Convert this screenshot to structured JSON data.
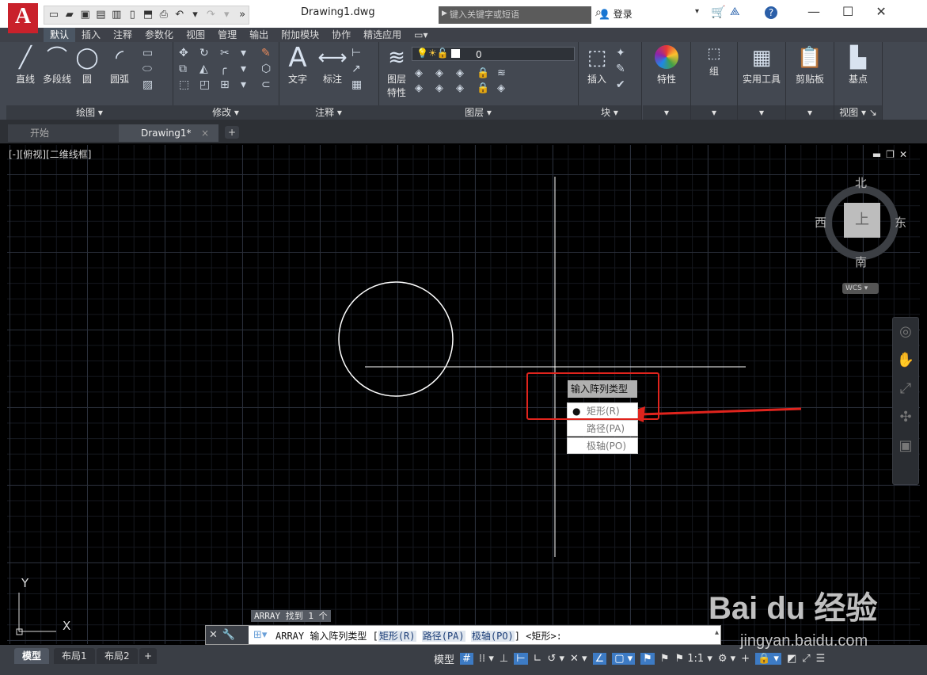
{
  "app": {
    "logo_letter": "A",
    "document_title": "Drawing1.dwg"
  },
  "search": {
    "placeholder": "键入关键字或短语"
  },
  "account": {
    "signin_label": "登录"
  },
  "ribbon_tabs": [
    "默认",
    "插入",
    "注释",
    "参数化",
    "视图",
    "管理",
    "输出",
    "附加模块",
    "协作",
    "精选应用"
  ],
  "ribbon_active_tab": "默认",
  "ribbon": {
    "draw": {
      "title": "绘图",
      "line": "直线",
      "polyline": "多段线",
      "circle": "圆",
      "arc": "圆弧"
    },
    "modify": {
      "title": "修改"
    },
    "annotation": {
      "title": "注释",
      "text": "文字",
      "dimension": "标注"
    },
    "layers": {
      "title": "图层",
      "layer_properties_line1": "图层",
      "layer_properties_line2": "特性",
      "current_layer": "0"
    },
    "block": {
      "title": "块",
      "insert": "插入"
    },
    "properties": {
      "label": "特性"
    },
    "groups": {
      "label": "组"
    },
    "utilities": {
      "label": "实用工具"
    },
    "clipboard": {
      "label": "剪贴板"
    },
    "view": {
      "base_point": "基点",
      "title": "视图"
    }
  },
  "doc_tabs": {
    "start": "开始",
    "drawing": "Drawing1*",
    "close": "×",
    "add": "+"
  },
  "viewport": {
    "label": "[-][俯视][二维线框]"
  },
  "viewcube": {
    "north": "北",
    "south": "南",
    "west": "西",
    "east": "东",
    "top": "上",
    "wcs": "WCS"
  },
  "context_menu": {
    "title": "输入阵列类型",
    "items": [
      "矩形(R)",
      "路径(PA)",
      "极轴(PO)"
    ],
    "selected_index": 0
  },
  "command": {
    "history": "ARRAY 找到 1 个",
    "prompt_cmd": "ARRAY 输入阵列类型 [",
    "opt1": "矩形(R)",
    "opt2": "路径(PA)",
    "opt3": "极轴(PO)",
    "prompt_tail": "] <矩形>:"
  },
  "ucs": {
    "x": "X",
    "y": "Y"
  },
  "layout_tabs": [
    "模型",
    "布局1",
    "布局2"
  ],
  "status": {
    "model_label": "模型",
    "scale": "1:1"
  },
  "watermark": {
    "brand": "Bai du 经验",
    "url": "jingyan.baidu.com"
  },
  "colors": {
    "accent_red": "#e0241d",
    "ribbon_bg": "#434851",
    "canvas_bg": "#000000",
    "logo_red": "#c9212b"
  }
}
